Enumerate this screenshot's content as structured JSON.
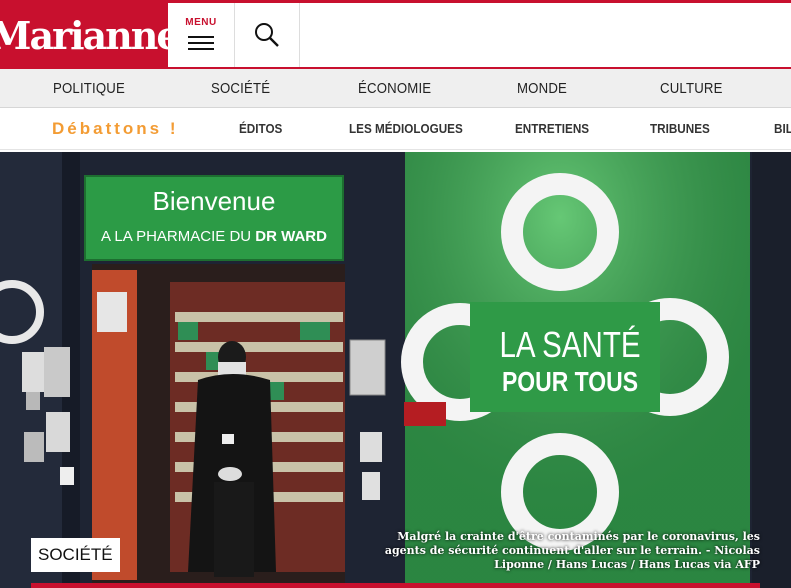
{
  "header": {
    "logo_text": "Marianne",
    "menu_label": "MENU"
  },
  "nav_primary": [
    "POLITIQUE",
    "SOCIÉTÉ",
    "ÉCONOMIE",
    "MONDE",
    "CULTURE"
  ],
  "nav_secondary": {
    "highlight": "Débattons !",
    "items": [
      "ÉDITOS",
      "LES MÉDIOLOGUES",
      "ENTRETIENS",
      "TRIBUNES",
      "BIL"
    ]
  },
  "hero": {
    "sign_line1": "Bienvenue",
    "sign_line2_a": "A LA PHARMACIE",
    "sign_line2_b": "DU",
    "sign_line2_c": "DR WARD",
    "poster_line1": "LA SANTÉ",
    "poster_line2": "POUR TOUS",
    "category": "SOCIÉTÉ",
    "caption": "Malgré la crainte d'être contaminés par le coronavirus, les agents de sécurité continuent d'aller sur le terrain. - Nicolas Liponne / Hans Lucas / Hans Lucas via AFP"
  },
  "colors": {
    "brand_red": "#c8102e",
    "debattons_orange": "#f39c34",
    "pharmacy_green": "#2e9e45"
  }
}
